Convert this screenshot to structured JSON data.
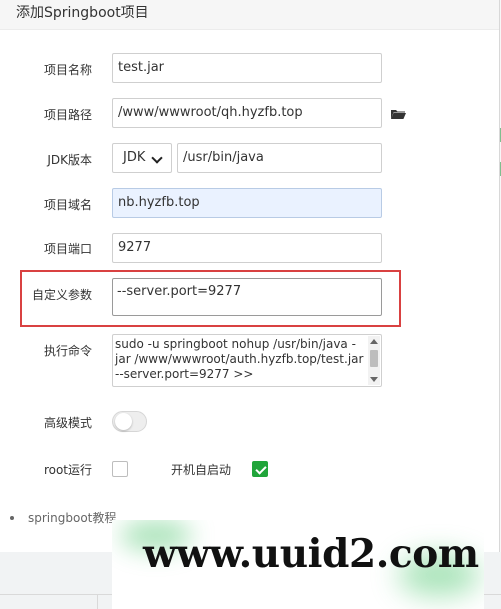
{
  "dialog": {
    "title": "添加Springboot项目"
  },
  "form": {
    "project_name": {
      "label": "项目名称",
      "value": "test.jar"
    },
    "project_path": {
      "label": "项目路径",
      "value": "/www/wwwroot/qh.hyzfb.top",
      "icon": "folder-open-icon"
    },
    "jdk_version": {
      "label": "JDK版本",
      "selected": "JDK",
      "path": "/usr/bin/java"
    },
    "project_domain": {
      "label": "项目域名",
      "value": "nb.hyzfb.top"
    },
    "project_port": {
      "label": "项目端口",
      "value": "9277"
    },
    "custom_params": {
      "label": "自定义参数",
      "value": "--server.port=9277"
    },
    "execute_command": {
      "label": "执行命令",
      "lines": [
        "sudo -u springboot nohup /usr/bin/java -",
        "jar  /www/wwwroot/auth.hyzfb.top/test.jar",
        "--server.port=9277 >>"
      ]
    },
    "advanced_mode": {
      "label": "高级模式",
      "enabled": false
    },
    "run_as_root": {
      "label": "root运行",
      "checked": false
    },
    "auto_start": {
      "label": "开机自启动",
      "checked": true
    }
  },
  "tips": {
    "text": "springboot教程"
  },
  "watermark": {
    "text": "www.uuid2.com"
  },
  "colors": {
    "highlight": "#d94141",
    "success": "#20a53a",
    "focused_input": "#eaf2ff",
    "watermark_glow": "#70d08a"
  }
}
